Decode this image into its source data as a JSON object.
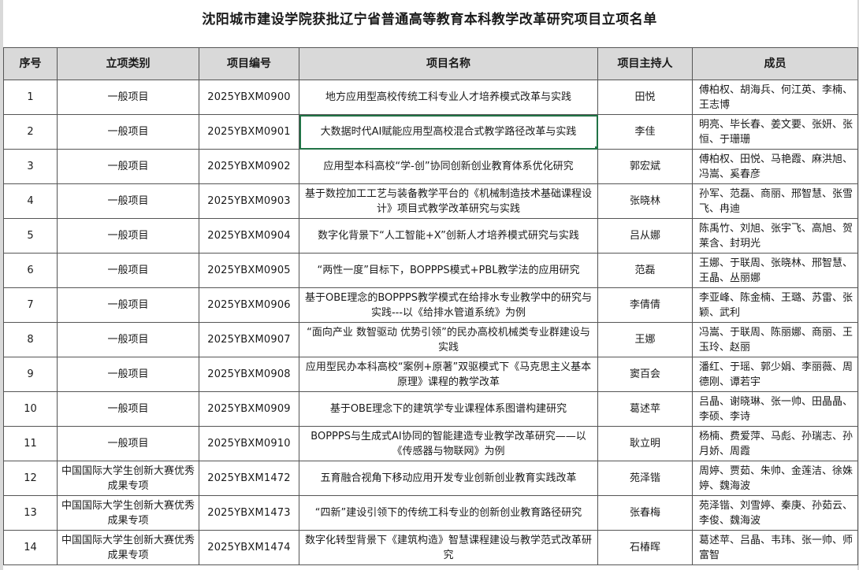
{
  "sheet": {
    "title": "沈阳城市建设学院获批辽宁省普通高等教育本科教学改革研究项目立项名单",
    "headers": [
      "序号",
      "立项类别",
      "项目编号",
      "项目名称",
      "项目主持人",
      "成员"
    ],
    "rows": [
      {
        "no": "1",
        "category": "一般项目",
        "code": "2025YBXM0900",
        "name": "地方应用型高校传统工科专业人才培养模式改革与实践",
        "host": "田悦",
        "members": "傅柏权、胡海兵、何江英、李楠、王志博"
      },
      {
        "no": "2",
        "category": "一般项目",
        "code": "2025YBXM0901",
        "name": "大数据时代AI赋能应用型高校混合式教学路径改革与实践",
        "host": "李佳",
        "members": "明亮、毕长春、姜文要、张妍、张恒、于珊珊"
      },
      {
        "no": "3",
        "category": "一般项目",
        "code": "2025YBXM0902",
        "name": "应用型本科高校“学-创”协同创新创业教育体系优化研究",
        "host": "郭宏斌",
        "members": "傅柏权、田悦、马艳霞、麻洪旭、冯嵩、奚春彦"
      },
      {
        "no": "4",
        "category": "一般项目",
        "code": "2025YBXM0903",
        "name": "基于数控加工工艺与装备教学平台的《机械制造技术基础课程设计》项目式教学改革研究与实践",
        "host": "张晓林",
        "members": "孙军、范磊、商丽、邢智慧、张雪飞、冉迪"
      },
      {
        "no": "5",
        "category": "一般项目",
        "code": "2025YBXM0904",
        "name": "数字化背景下“人工智能+X”创新人才培养模式研究与实践",
        "host": "吕从娜",
        "members": "陈禹竹、刘旭、张宇飞、高旭、贺莱含、封玥光"
      },
      {
        "no": "6",
        "category": "一般项目",
        "code": "2025YBXM0905",
        "name": "“两性一度”目标下，BOPPPS模式+PBL教学法的应用研究",
        "host": "范磊",
        "members": "王娜、于联周、张晓林、邢智慧、王晶、丛丽娜"
      },
      {
        "no": "7",
        "category": "一般项目",
        "code": "2025YBXM0906",
        "name": "基于OBE理念的BOPPPS教学模式在给排水专业教学中的研究与实践---以《给排水管道系统》为例",
        "host": "李倩倩",
        "members": "李亚峰、陈金楠、王璐、苏雷、张颖、武利"
      },
      {
        "no": "8",
        "category": "一般项目",
        "code": "2025YBXM0907",
        "name": "“面向产业 数智驱动 优势引领”的民办高校机械类专业群建设与实践",
        "host": "王娜",
        "members": "冯嵩、于联周、陈丽娜、商丽、王玉玲、赵丽"
      },
      {
        "no": "9",
        "category": "一般项目",
        "code": "2025YBXM0908",
        "name": "应用型民办本科高校“案例+原著”双驱模式下《马克思主义基本原理》课程的教学改革",
        "host": "窦百会",
        "members": "潘红、于瑶、郭少娟、李丽薇、周德刚、谭若宇"
      },
      {
        "no": "10",
        "category": "一般项目",
        "code": "2025YBXM0909",
        "name": "基于OBE理念下的建筑学专业课程体系图谱构建研究",
        "host": "葛述苹",
        "members": "吕晶、谢晓琳、张一帅、田晶晶、李硕、李诗"
      },
      {
        "no": "11",
        "category": "一般项目",
        "code": "2025YBXM0910",
        "name": "BOPPPS与生成式AI协同的智能建造专业教学改革研究——以《传感器与物联网》为例",
        "host": "耿立明",
        "members": "杨楠、费爱萍、马彪、孙瑞志、孙月娇、周霞"
      },
      {
        "no": "12",
        "category": "中国国际大学生创新大赛优秀成果专项",
        "code": "2025YBXM1472",
        "name": "五育融合视角下移动应用开发专业创新创业教育实践改革",
        "host": "苑泽锴",
        "members": "周婷、贾茹、朱帅、金莲洁、徐姝婷、魏海波"
      },
      {
        "no": "13",
        "category": "中国国际大学生创新大赛优秀成果专项",
        "code": "2025YBXM1473",
        "name": "“四新”建设引领下的传统工科专业的创新创业教育路径研究",
        "host": "张春梅",
        "members": "苑泽锴、刘雪婷、秦庚、孙茹云、李俊、魏海波"
      },
      {
        "no": "14",
        "category": "中国国际大学生创新大赛优秀成果专项",
        "code": "2025YBXM1474",
        "name": "数字化转型背景下《建筑构造》智慧课程建设与教学范式改革研究",
        "host": "石椿晖",
        "members": "葛述苹、吕晶、韦玮、张一帅、师富智"
      }
    ]
  }
}
